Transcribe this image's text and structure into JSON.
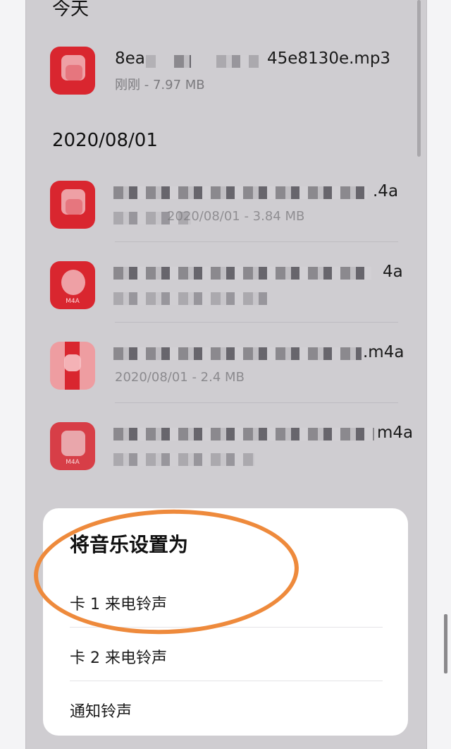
{
  "sections": [
    {
      "label": "今天"
    },
    {
      "label": "2020/08/01"
    }
  ],
  "files": [
    {
      "name_start": "8ea",
      "name_end": "45e8130e.mp3",
      "meta": "刚刚 - 7.97 MB",
      "icon": "music-file-icon"
    },
    {
      "name_end": ".4a",
      "meta": "2020/08/01 - 3.84 MB",
      "icon": "music-file-icon"
    },
    {
      "name_end": "4a",
      "meta": "",
      "icon_tag": "M4A",
      "icon": "m4a-file-icon"
    },
    {
      "name_end": ".m4a",
      "meta": "2020/08/01 - 2.4 MB",
      "icon": "m4a-file-icon"
    },
    {
      "name_end": "m4a",
      "meta": "",
      "icon_tag": "M4A",
      "icon": "m4a-file-icon"
    }
  ],
  "sheet": {
    "title": "将音乐设置为",
    "options": [
      "卡 1 来电铃声",
      "卡 2 来电铃声",
      "通知铃声"
    ]
  },
  "colors": {
    "background": "#cfcdd1",
    "icon_red": "#d9262f",
    "annotation": "#ee8a3c"
  }
}
